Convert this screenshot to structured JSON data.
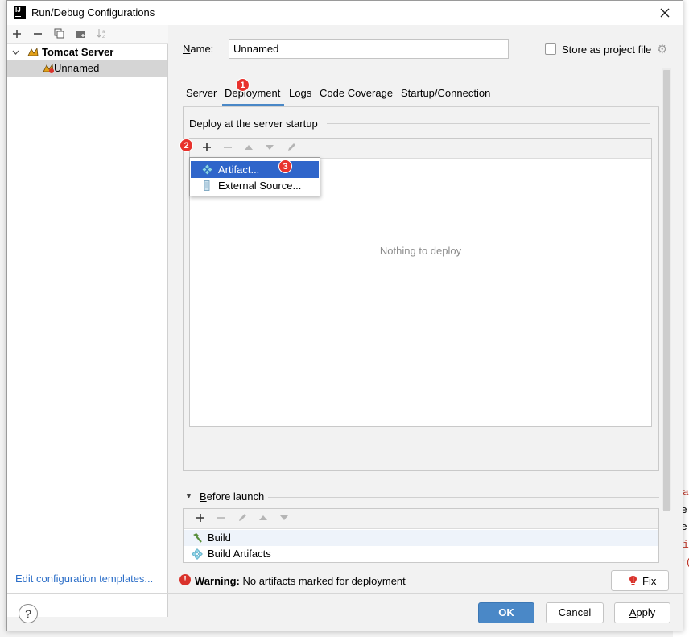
{
  "window": {
    "title": "Run/Debug Configurations",
    "app_logo": "IJ"
  },
  "left_toolbar": {
    "icons": [
      "plus-icon",
      "minus-icon",
      "copy-icon",
      "folder-icon",
      "sort-icon"
    ]
  },
  "tree": {
    "group_label": "Tomcat Server",
    "child_label": "Unnamed"
  },
  "edit_templates_link": "Edit configuration templates...",
  "name_label": "Name:",
  "name_value": "Unnamed",
  "store_label": "Store as project file",
  "store_checked": false,
  "tabs": [
    "Server",
    "Deployment",
    "Logs",
    "Code Coverage",
    "Startup/Connection"
  ],
  "active_tab": "Deployment",
  "deploy_header": "Deploy at the server startup",
  "deploy_toolbar_icons": [
    "plus-icon",
    "minus-icon",
    "move-up-icon",
    "move-down-icon",
    "edit-icon"
  ],
  "empty_text": "Nothing to deploy",
  "popup_menu": [
    {
      "label": "Artifact...",
      "icon": "artifact-icon",
      "selected": true
    },
    {
      "label": "External Source...",
      "icon": "external-source-icon",
      "selected": false
    }
  ],
  "badges": [
    "1",
    "2",
    "3"
  ],
  "before_launch": {
    "label": "Before launch",
    "toolbar_icons": [
      "plus-icon",
      "minus-icon",
      "edit-icon",
      "move-up-icon",
      "move-down-icon"
    ],
    "items": [
      {
        "label": "Build",
        "icon": "hammer-icon"
      },
      {
        "label": "Build Artifacts",
        "icon": "artifact-icon"
      }
    ]
  },
  "warning": {
    "bold": "Warning:",
    "text": "No artifacts marked for deployment"
  },
  "fix_label": "Fix",
  "buttons": {
    "help": "?",
    "ok": "OK",
    "cancel": "Cancel",
    "apply": "Apply"
  },
  "background_glyphs": [
    ":",
    "a",
    "e",
    "e.",
    "i",
    "r("
  ],
  "colors": {
    "accent": "#4a88c7",
    "selection": "#2f65ca",
    "badge": "#e8322d",
    "link": "#2d6fc8"
  }
}
